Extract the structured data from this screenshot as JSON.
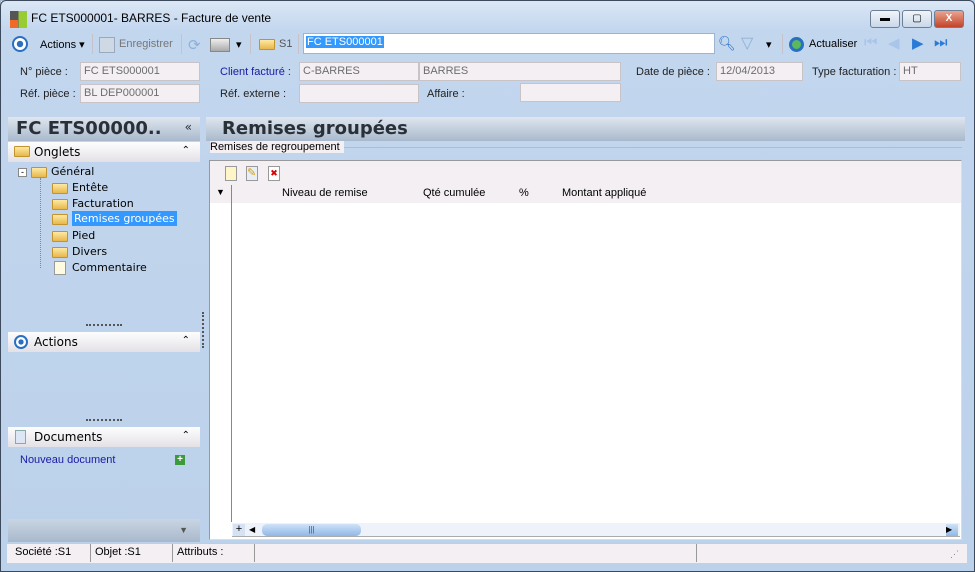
{
  "window": {
    "title": "FC ETS000001- BARRES -  Facture de vente",
    "min": "▬",
    "max": "▢",
    "close": "X"
  },
  "toolbar": {
    "actions": "Actions",
    "save": "Enregistrer",
    "company": "S1",
    "search_value": "FC ETS000001",
    "refresh": "Actualiser"
  },
  "form": {
    "num_piece_label": "N° pièce :",
    "num_piece": "FC ETS000001",
    "ref_piece_label": "Réf. pièce :",
    "ref_piece": "BL DEP000001",
    "client_label": "Client facturé :",
    "client_code": "C-BARRES",
    "client_name": "BARRES",
    "ref_ext_label": "Réf. externe :",
    "ref_ext": "",
    "affaire_label": "Affaire :",
    "affaire": "",
    "date_label": "Date de pièce :",
    "date": "12/04/2013",
    "type_label": "Type facturation :",
    "type": "HT"
  },
  "left": {
    "header": "FC ETS00000..",
    "collapse": "«",
    "onglets": "Onglets",
    "tree_root": "Général",
    "tree": [
      "Entête",
      "Facturation",
      "Remises groupées",
      "Pied",
      "Divers",
      "Commentaire"
    ],
    "actions": "Actions",
    "documents": "Documents",
    "new_doc": "Nouveau document",
    "chevron": "⌃"
  },
  "main": {
    "header": "Remises groupées",
    "group": "Remises de regroupement",
    "columns": [
      "Niveau de remise",
      "Qté cumulée",
      "%",
      "Montant appliqué"
    ]
  },
  "status": {
    "societe": "Société :S1",
    "objet": "Objet :S1",
    "attributs": "Attributs :"
  },
  "colors": {
    "selection": "#3399ff",
    "link": "#1a1aa6"
  }
}
